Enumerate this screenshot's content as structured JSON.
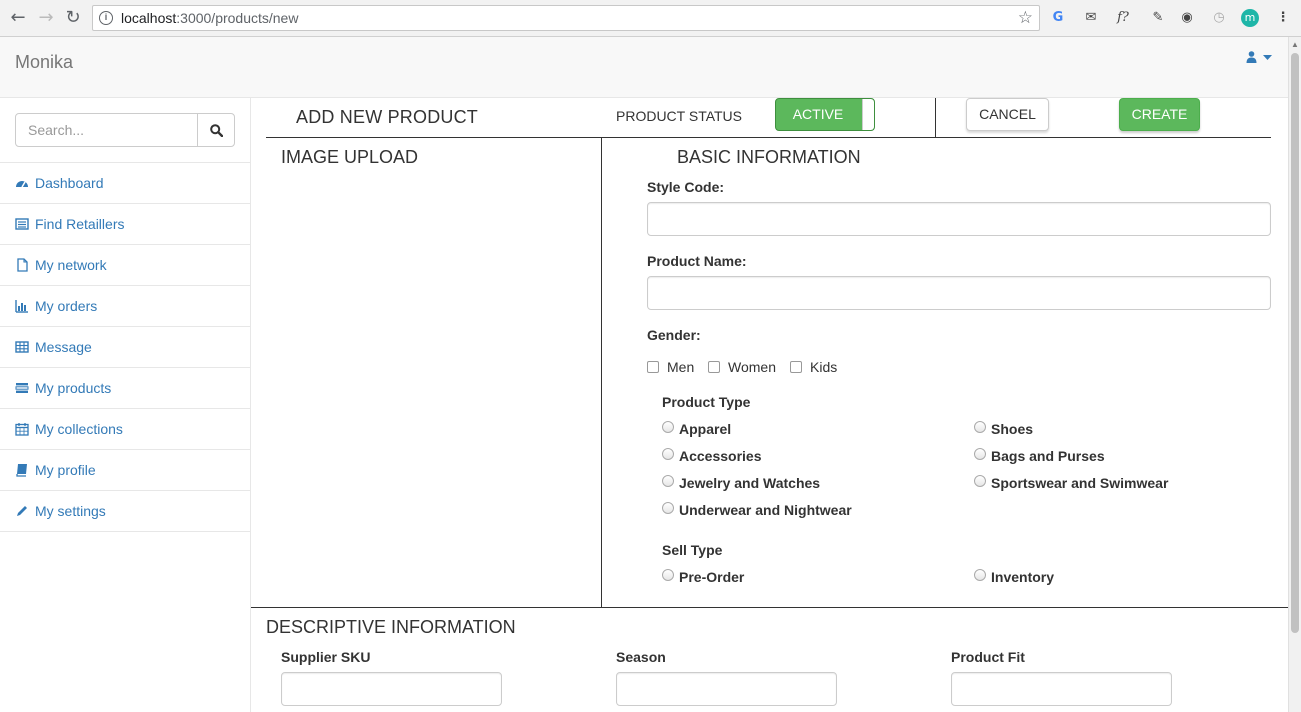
{
  "browser": {
    "url_host": "localhost",
    "url_path": ":3000/products/new",
    "back_icon": "arrow-left-icon",
    "forward_icon": "arrow-right-icon",
    "reload_icon": "reload-icon"
  },
  "navbar": {
    "brand": "Monika",
    "user_icon": "user-icon"
  },
  "sidebar": {
    "search_placeholder": "Search...",
    "items": [
      {
        "label": "Dashboard",
        "icon": "dashboard-icon"
      },
      {
        "label": "Find Retaillers",
        "icon": "list-icon"
      },
      {
        "label": "My network",
        "icon": "file-icon"
      },
      {
        "label": "My orders",
        "icon": "bar-chart-icon"
      },
      {
        "label": "Message",
        "icon": "table-icon"
      },
      {
        "label": "My products",
        "icon": "tasks-icon"
      },
      {
        "label": "My collections",
        "icon": "calendar-icon"
      },
      {
        "label": "My profile",
        "icon": "book-icon"
      },
      {
        "label": "My settings",
        "icon": "pencil-icon"
      }
    ]
  },
  "header": {
    "title": "ADD NEW PRODUCT",
    "status_label": "PRODUCT STATUS",
    "status_value": "ACTIVE",
    "cancel_label": "CANCEL",
    "create_label": "CREATE"
  },
  "image_upload": {
    "title": "IMAGE UPLOAD"
  },
  "basic_info": {
    "title": "BASIC INFORMATION",
    "style_code_label": "Style Code:",
    "style_code_value": "",
    "product_name_label": "Product Name:",
    "product_name_value": "",
    "gender_label": "Gender:",
    "gender_options": [
      "Men",
      "Women",
      "Kids"
    ],
    "product_type_label": "Product Type",
    "product_types_left": [
      "Apparel",
      "Accessories",
      "Jewelry and Watches",
      "Underwear and Nightwear"
    ],
    "product_types_right": [
      "Shoes",
      "Bags and Purses",
      "Sportswear and Swimwear"
    ],
    "sell_type_label": "Sell Type",
    "sell_types": [
      "Pre-Order",
      "Inventory"
    ]
  },
  "descriptive": {
    "title": "DESCRIPTIVE INFORMATION",
    "fields": [
      "Supplier SKU",
      "Season",
      "Product Fit"
    ]
  },
  "colors": {
    "link": "#337ab7",
    "success": "#5cb85c"
  }
}
